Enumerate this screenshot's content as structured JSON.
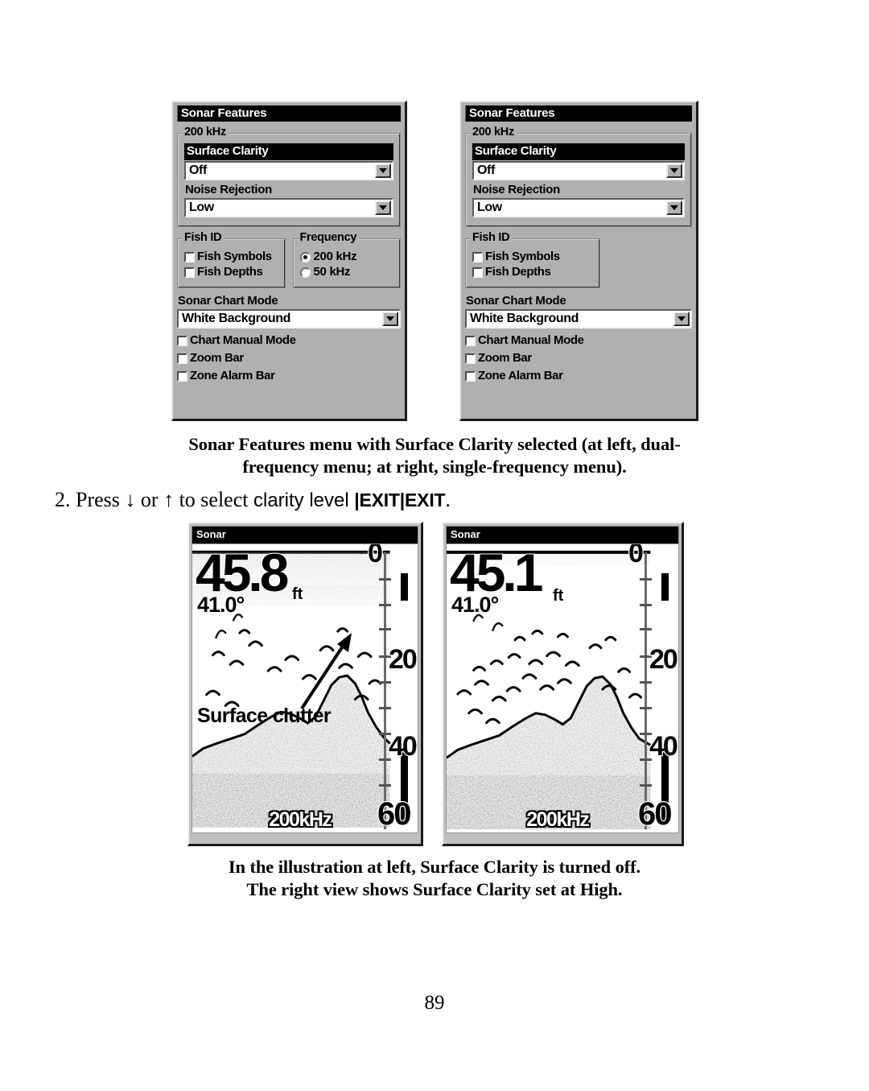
{
  "page": {
    "number": "89"
  },
  "menus": [
    {
      "id": "dual-frequency",
      "title": "Sonar Features",
      "group_frequency_label": "200 kHz",
      "surface_clarity": {
        "label": "Surface Clarity",
        "value": "Off",
        "selected": true
      },
      "noise_rejection": {
        "label": "Noise Rejection",
        "value": "Low"
      },
      "fish_id": {
        "label": "Fish ID",
        "items": [
          {
            "label": "Fish Symbols",
            "checked": false
          },
          {
            "label": "Fish Depths",
            "checked": false
          }
        ]
      },
      "frequency": {
        "label": "Frequency",
        "options": [
          {
            "label": "200 kHz",
            "selected": true
          },
          {
            "label": "50 kHz",
            "selected": false
          }
        ]
      },
      "sonar_chart_mode": {
        "label": "Sonar Chart Mode",
        "value": "White Background"
      },
      "toggles": [
        {
          "label": "Chart Manual Mode",
          "checked": false
        },
        {
          "label": "Zoom Bar",
          "checked": false
        },
        {
          "label": "Zone Alarm Bar",
          "checked": false
        }
      ]
    },
    {
      "id": "single-frequency",
      "title": "Sonar Features",
      "group_frequency_label": "200 kHz",
      "surface_clarity": {
        "label": "Surface Clarity",
        "value": "Off",
        "selected": true
      },
      "noise_rejection": {
        "label": "Noise Rejection",
        "value": "Low"
      },
      "fish_id": {
        "label": "Fish ID",
        "items": [
          {
            "label": "Fish Symbols",
            "checked": false
          },
          {
            "label": "Fish Depths",
            "checked": false
          }
        ]
      },
      "sonar_chart_mode": {
        "label": "Sonar Chart Mode",
        "value": "White Background"
      },
      "toggles": [
        {
          "label": "Chart Manual Mode",
          "checked": false
        },
        {
          "label": "Zoom Bar",
          "checked": false
        },
        {
          "label": "Zone Alarm Bar",
          "checked": false
        }
      ]
    }
  ],
  "caption_top": {
    "line1": "Sonar Features menu with Surface Clarity selected (at left, dual-",
    "line2": "frequency menu; at right, single-frequency menu)."
  },
  "step": {
    "number": "2.",
    "press": "Press",
    "down_arrow": "↓",
    "or": "or",
    "up_arrow": "↑",
    "to_select": "to select",
    "object": "clarity level",
    "pipe1": "|",
    "key1": "EXIT",
    "pipe2": "|",
    "key2": "EXIT",
    "period": "."
  },
  "sonar_screens": [
    {
      "id": "surface-clarity-off",
      "title": "Sonar",
      "depth": "45.8",
      "depth_unit": "ft",
      "temperature": "41.0°",
      "frequency": "200kHz",
      "scale_labels": [
        "0",
        "20",
        "40",
        "60"
      ],
      "annotation": "Surface clutter"
    },
    {
      "id": "surface-clarity-high",
      "title": "Sonar",
      "depth": "45.1",
      "depth_unit": "ft",
      "temperature": "41.0°",
      "frequency": "200kHz",
      "scale_labels": [
        "0",
        "20",
        "40",
        "60"
      ],
      "annotation": ""
    }
  ],
  "caption_bottom": {
    "line1": "In the illustration at left, Surface Clarity is turned off.",
    "line2": "The right view shows Surface Clarity set at High."
  },
  "colors": {
    "panel_face": "#b0b0b0",
    "titlebar": "#000000",
    "highlight_text": "#ffffff",
    "screen_bg": "#ffffff"
  }
}
